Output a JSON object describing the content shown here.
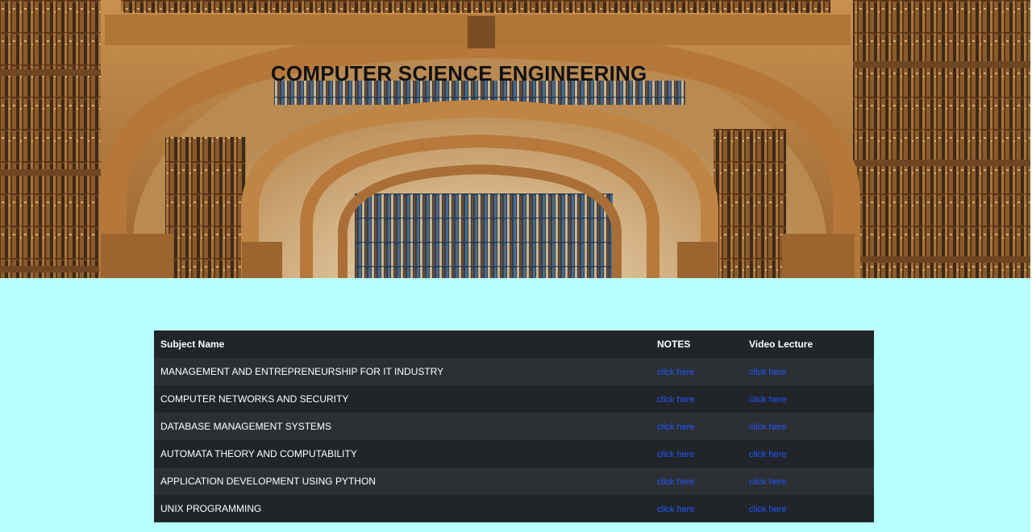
{
  "banner": {
    "title": "COMPUTER SCIENCE ENGINEERING",
    "image": "library-arches-bookshelves"
  },
  "table": {
    "headers": {
      "subject": "Subject Name",
      "notes": "NOTES",
      "video": "Video Lecture"
    },
    "rows": [
      {
        "subject": "MANAGEMENT AND ENTREPRENEURSHIP FOR IT INDUSTRY",
        "notes": "click here",
        "video": "click here"
      },
      {
        "subject": "COMPUTER NETWORKS AND SECURITY",
        "notes": "click here",
        "video": "click here"
      },
      {
        "subject": "DATABASE MANAGEMENT SYSTEMS",
        "notes": "click here",
        "video": "click here"
      },
      {
        "subject": "AUTOMATA THEORY AND COMPUTABILITY",
        "notes": "click here",
        "video": "click here"
      },
      {
        "subject": "APPLICATION DEVELOPMENT USING PYTHON",
        "notes": "click here",
        "video": "click here"
      },
      {
        "subject": "UNIX PROGRAMMING",
        "notes": "click here",
        "video": "click here"
      }
    ]
  },
  "colors": {
    "page_background": "#b8ffff",
    "table_header": "#212529",
    "table_row_odd": "#2c3034",
    "table_row_even": "#212529",
    "link": "#2255ff"
  }
}
